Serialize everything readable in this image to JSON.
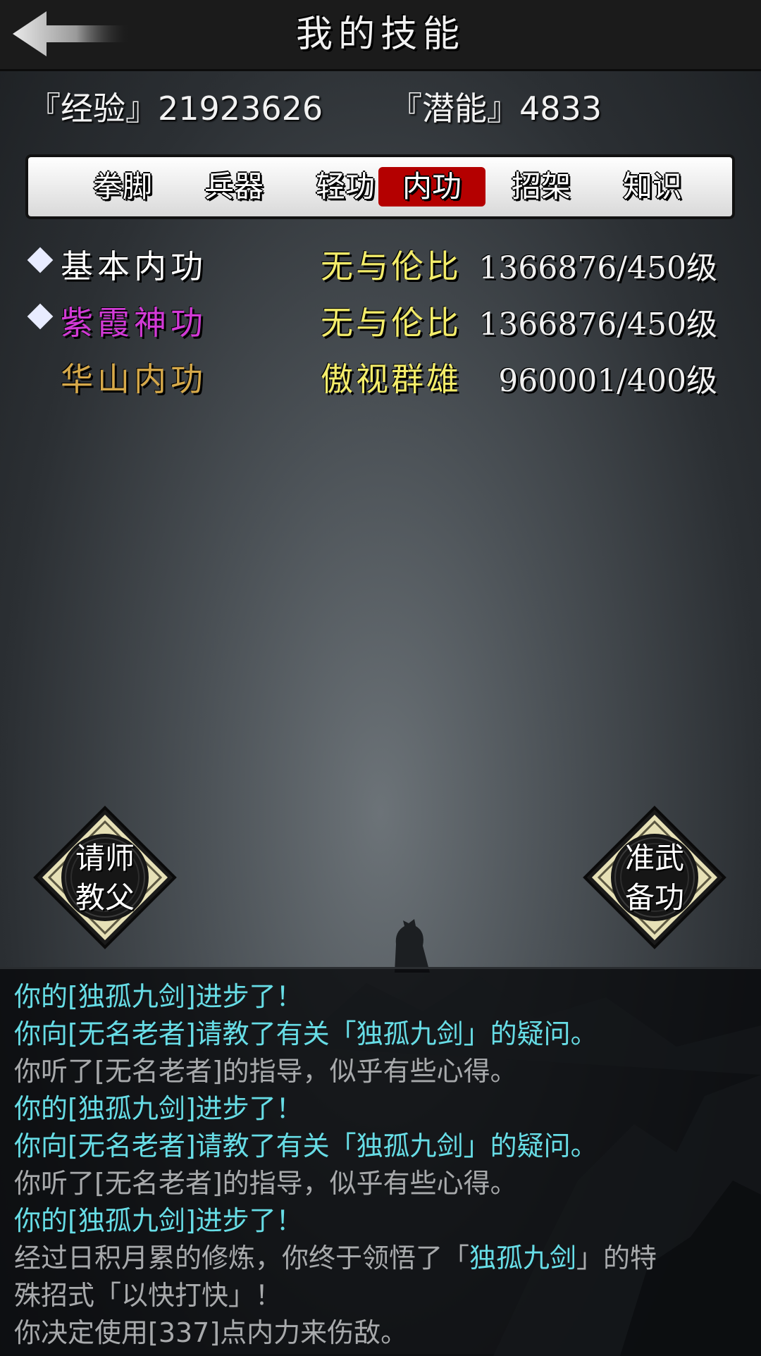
{
  "header": {
    "title": "我的技能",
    "back_icon": "back-arrow-icon"
  },
  "stats": {
    "exp_text": "『经验』21923626",
    "potential_text": "『潜能』4833"
  },
  "tabs": [
    {
      "label": "拳脚",
      "active": false
    },
    {
      "label": "兵器",
      "active": false
    },
    {
      "label": "轻功",
      "active": false
    },
    {
      "label": "内功",
      "active": true
    },
    {
      "label": "招架",
      "active": false
    },
    {
      "label": "知识",
      "active": false
    }
  ],
  "colors": {
    "tab_active": "#b40000",
    "level_text": "#f3ec6a",
    "skill_white": "#ffffff",
    "skill_purple": "#d23ad6",
    "skill_gold": "#d6a94a",
    "log_cyan": "#67dde6",
    "log_gray": "#a8aaac"
  },
  "skills": [
    {
      "name": "基本内功",
      "level": "无与伦比",
      "progress": "1366876/450级",
      "marked": true,
      "color": "#ffffff"
    },
    {
      "name": "紫霞神功",
      "level": "无与伦比",
      "progress": "1366876/450级",
      "marked": true,
      "color": "#d23ad6"
    },
    {
      "name": "华山内功",
      "level": "傲视群雄",
      "progress": "960001/400级",
      "marked": false,
      "color": "#d6a94a"
    }
  ],
  "buttons": {
    "left_label_1": "请师",
    "left_label_2": "教父",
    "right_label_1": "准武",
    "right_label_2": "备功"
  },
  "log": [
    {
      "text": "你的[独孤九剑]进步了！",
      "style": "cyan"
    },
    {
      "text": "你向[无名老者]请教了有关「独孤九剑」的疑问。",
      "style": "cyan"
    },
    {
      "text": "你听了[无名老者]的指导，似乎有些心得。",
      "style": "gray"
    },
    {
      "text": "你的[独孤九剑]进步了！",
      "style": "cyan"
    },
    {
      "text": "你向[无名老者]请教了有关「独孤九剑」的疑问。",
      "style": "cyan"
    },
    {
      "text": "你听了[无名老者]的指导，似乎有些心得。",
      "style": "gray"
    },
    {
      "text": "你的[独孤九剑]进步了！",
      "style": "cyan"
    },
    {
      "text_a": "经过日积月累的修炼，你终于领悟了「",
      "text_b": "独孤九剑",
      "text_c": "」的特",
      "style": "mixed"
    },
    {
      "text": "殊招式「以快打快」！",
      "style": "gray"
    },
    {
      "text": "你决定使用[337]点内力来伤敌。",
      "style": "gray"
    }
  ]
}
